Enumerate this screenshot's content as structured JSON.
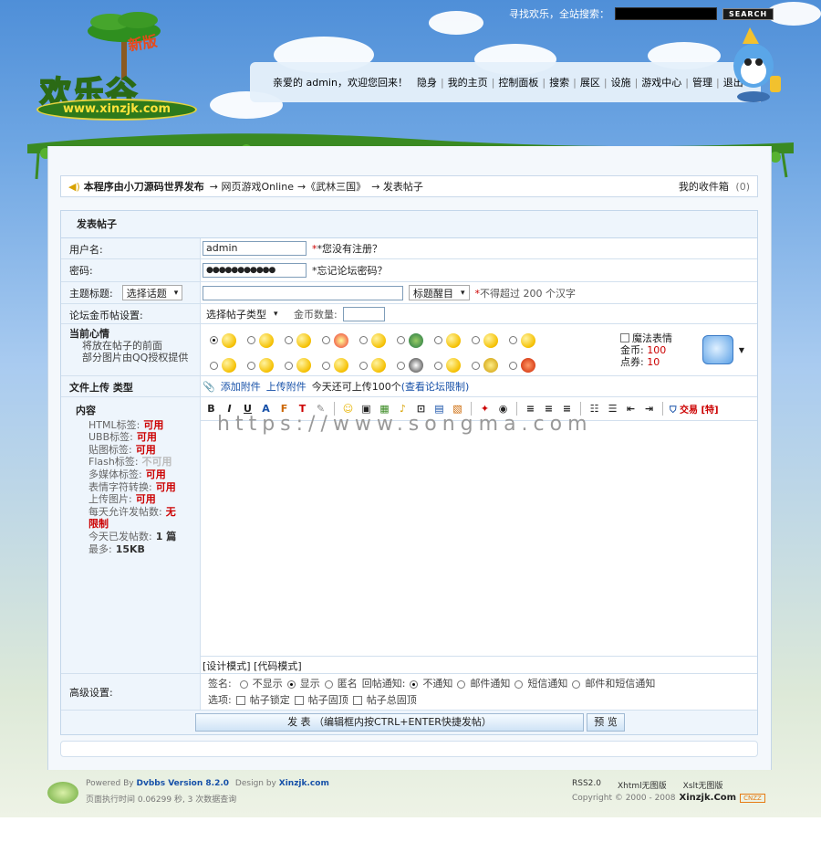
{
  "header": {
    "logo_new": "新版",
    "logo_title": "欢乐谷",
    "logo_url": "www.xinzjk.com",
    "search_label": "寻找欢乐，全站搜索：",
    "search_button": "SEARCH",
    "nav_items": [
      "亲爱的 admin，欢迎您回来！",
      "隐身",
      "我的主页",
      "控制面板",
      "搜索",
      "展区",
      "设施",
      "游戏中心",
      "管理",
      "退出"
    ]
  },
  "breadcrumb": {
    "site": "本程序由小刀源码世界发布",
    "items": [
      "→ 网页游戏Online",
      "→《武林三国》",
      "→ 发表帖子"
    ],
    "inbox_label": "我的收件箱",
    "inbox_count": "(0)"
  },
  "form": {
    "title": "发表帖子",
    "username_label": "用户名:",
    "username_value": "admin",
    "username_hint": "*您没有注册？",
    "password_label": "密码:",
    "password_value": "●●●●●●●●●●●",
    "password_hint": "*忘记论坛密码？",
    "subject_label": "主题标题:",
    "subject_select": "选择话题",
    "subject_style": "标题醒目",
    "subject_hint_star": "*",
    "subject_hint": "不得超过 200 个汉字",
    "gold_label": "论坛金币帖设置:",
    "gold_select": "选择帖子类型",
    "gold_amount_label": "金币数量:",
    "mood_label": "当前心情",
    "mood_desc1": "将放在帖子的前面",
    "mood_desc2": "部分图片由QQ授权提供",
    "magic_label": "魔法表情",
    "gold_coin_label": "金币:",
    "gold_coin_value": "100",
    "points_label": "点券:",
    "points_value": "10",
    "upload_label": "文件上传 类型",
    "add_attachment": "添加附件",
    "upload_attachment": "上传附件",
    "upload_today": "今天还可上传100个",
    "upload_limit_link": "(查看论坛限制)",
    "content_label": "内容",
    "rules": [
      {
        "name": "HTML标签:",
        "value": "可用",
        "color": "#c00"
      },
      {
        "name": "UBB标签:",
        "value": "可用",
        "color": "#c00"
      },
      {
        "name": "贴图标签:",
        "value": "可用",
        "color": "#c00"
      },
      {
        "name": "Flash标签:",
        "value": "不可用",
        "color": "#bbb"
      },
      {
        "name": "多媒体标签:",
        "value": "可用",
        "color": "#c00"
      },
      {
        "name": "表情字符转换:",
        "value": "可用",
        "color": "#c00"
      },
      {
        "name": "上传图片:",
        "value": "可用",
        "color": "#c00"
      },
      {
        "name": "每天允许发帖数:",
        "value": "无限制",
        "color": "#c00"
      },
      {
        "name": "今天已发帖数:",
        "value": "1 篇",
        "color": "#333"
      },
      {
        "name": "最多:",
        "value": "15KB",
        "color": "#333"
      }
    ],
    "toolbar_trade": "交易",
    "toolbar_special": "[特]",
    "editor_modes": "[设计模式] [代码模式]",
    "advanced_label": "高级设置:",
    "signature_label": "签名:",
    "sig_options": [
      "不显示",
      "显示",
      "匿名"
    ],
    "notify_label": "回帖通知:",
    "notify_options": [
      "不通知",
      "邮件通知",
      "短信通知",
      "邮件和短信通知"
    ],
    "options_label": "选项:",
    "option_checks": [
      "帖子锁定",
      "帖子固顶",
      "帖子总固顶"
    ],
    "submit_button": "发 表 （编辑框内按CTRL+ENTER快捷发帖）",
    "preview_button": "预 览"
  },
  "watermark": "https://www.songma.com",
  "footer": {
    "powered": "Powered By",
    "powered_link": "Dvbbs Version 8.2.0",
    "design": "Design by",
    "design_link": "Xinzjk.com",
    "exec_time": "页面执行时间 0.06299 秒, 3 次数据查询",
    "links": [
      "RSS2.0",
      "Xhtml无图版",
      "Xslt无图版"
    ],
    "copyright": "Copyright © 2000 - 2008",
    "copyright_site": "Xinzjk.Com",
    "badge": "CNZZ"
  },
  "colors": {
    "accent_red": "#cc0000",
    "link_blue": "#1650a8",
    "row_bg": "#eef5fc"
  }
}
